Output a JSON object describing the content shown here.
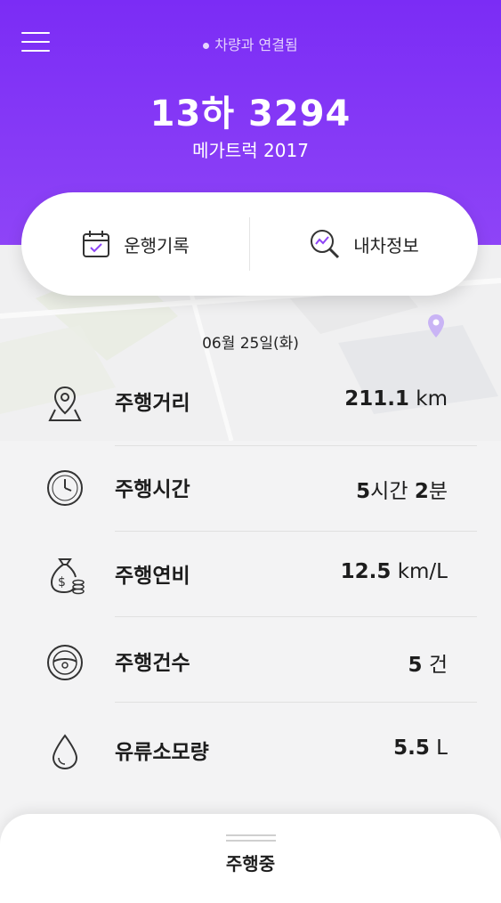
{
  "header": {
    "connection_status": "차량과 연결됨",
    "plate": "13하 3294",
    "model": "메가트럭 2017",
    "color": "#7b2cf5"
  },
  "actions": {
    "log_label": "운행기록",
    "info_label": "내차정보"
  },
  "date": "06월 25일(화)",
  "stats": [
    {
      "label": "주행거리",
      "value": "211.1",
      "unit": " km",
      "icon": "location-icon"
    },
    {
      "label": "주행시간",
      "value1": "5",
      "unit1": "시간 ",
      "value2": "2",
      "unit2": "분",
      "icon": "clock-icon"
    },
    {
      "label": "주행연비",
      "value": "12.5",
      "unit": " km/L",
      "icon": "money-bag-icon"
    },
    {
      "label": "주행건수",
      "value": "5",
      "unit": " 건",
      "icon": "steering-wheel-icon"
    },
    {
      "label": "유류소모량",
      "value": "5.5",
      "unit": " L",
      "icon": "drop-icon"
    }
  ],
  "bottom_sheet": {
    "title": "주행중"
  }
}
